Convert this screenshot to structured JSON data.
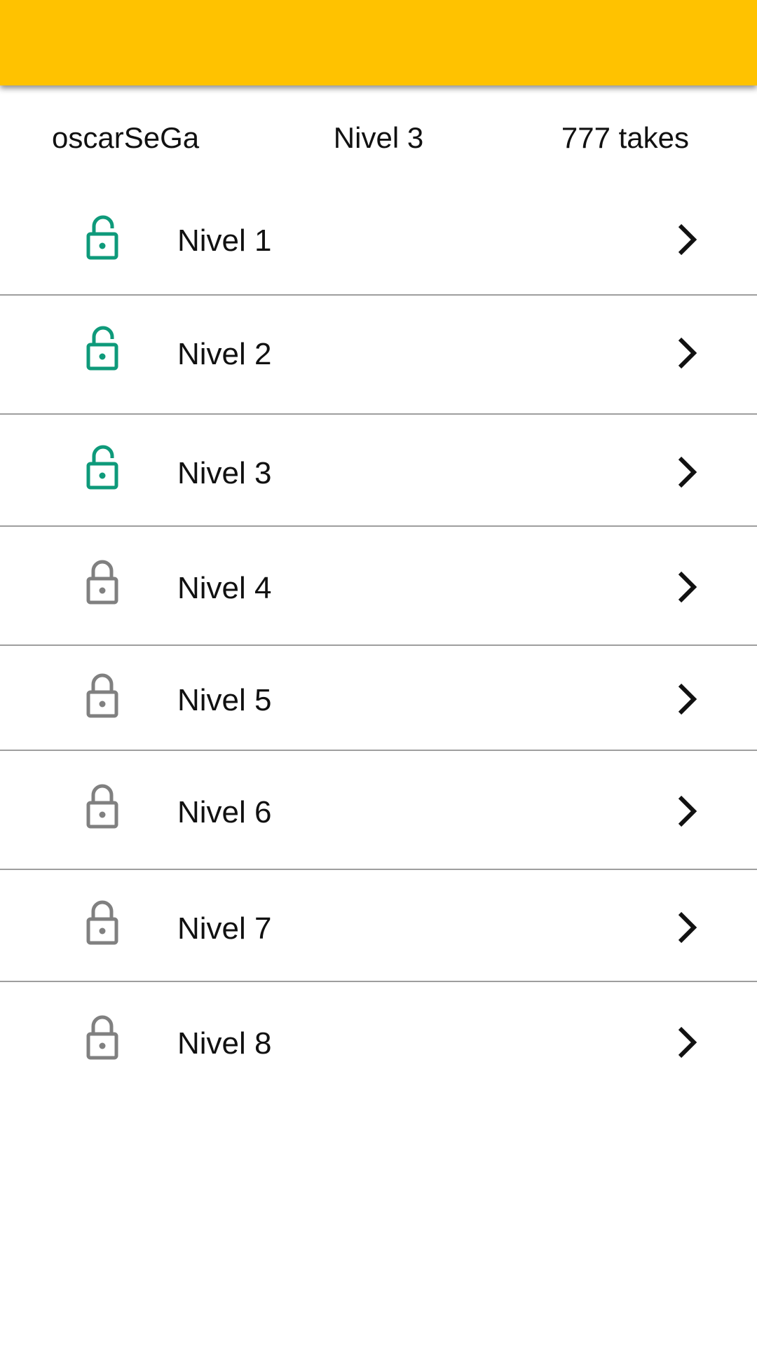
{
  "colors": {
    "appbar": "#FFC200",
    "unlocked_icon": "#0E9A7A",
    "locked_icon": "#808080",
    "divider": "#9E9E9E"
  },
  "header": {
    "username": "oscarSeGa",
    "current_level": "Nivel 3",
    "takes": "777 takes"
  },
  "levels": [
    {
      "label": "Nivel 1",
      "icon": "lock-open-icon",
      "unlocked": true
    },
    {
      "label": "Nivel 2",
      "icon": "lock-open-icon",
      "unlocked": true
    },
    {
      "label": "Nivel 3",
      "icon": "lock-open-icon",
      "unlocked": true
    },
    {
      "label": "Nivel 4",
      "icon": "lock-closed-icon",
      "unlocked": false
    },
    {
      "label": "Nivel 5",
      "icon": "lock-closed-icon",
      "unlocked": false
    },
    {
      "label": "Nivel 6",
      "icon": "lock-closed-icon",
      "unlocked": false
    },
    {
      "label": "Nivel 7",
      "icon": "lock-closed-icon",
      "unlocked": false
    },
    {
      "label": "Nivel 8",
      "icon": "lock-closed-icon",
      "unlocked": false
    }
  ]
}
